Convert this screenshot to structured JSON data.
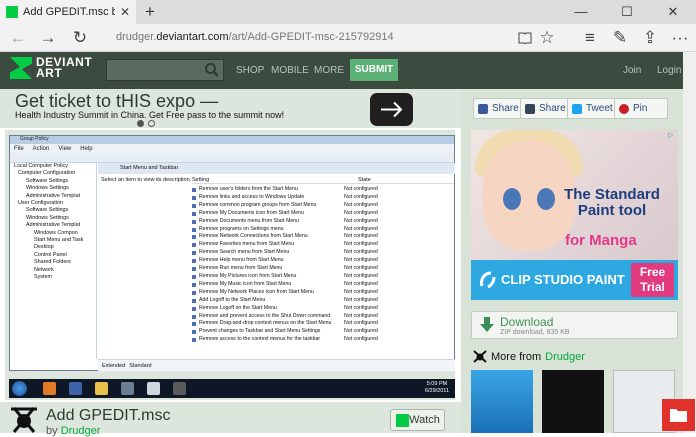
{
  "browser": {
    "tab_title": "Add GPEDIT.msc by Dru",
    "new_tab": "+",
    "url_prefix": "drudger.",
    "url_domain": "deviantart.com",
    "url_path": "/art/Add-GPEDIT-msc-215792914"
  },
  "site": {
    "logo_line1": "DEVIANT",
    "logo_line2": "ART",
    "nav": [
      "SHOP",
      "MOBILE",
      "MORE"
    ],
    "submit_label": "SUBMIT",
    "join": "Join",
    "login": "Login"
  },
  "promo": {
    "title": "Get ticket to tHIS expo —",
    "subtitle": "Health Industry Summit in China. Get Free pass to the summit now!"
  },
  "screenshot": {
    "window_title": "Group Policy",
    "menu": [
      "File",
      "Action",
      "View",
      "Help"
    ],
    "tree": [
      "Local Computer Policy",
      "Computer Configuration",
      "Software Settings",
      "Windows Settings",
      "Administrative Templat",
      "User Configuration",
      "Software Settings",
      "Windows Settings",
      "Administrative Templat",
      "Windows Compon",
      "Start Menu and Task",
      "Desktop",
      "Control Panel",
      "Shared Folders",
      "Network",
      "System"
    ],
    "folder_header": "Start Menu and Taskbar",
    "description": "Select an item to view its description.",
    "col_setting": "Setting",
    "col_state": "State",
    "settings": [
      "Remove user's folders from the Start Menu",
      "Remove links and access to Windows Update",
      "Remove common program groups from Start Menu",
      "Remove My Documents icon from Start Menu",
      "Remove Documents menu from Start Menu",
      "Remove programs on Settings menu",
      "Remove Network Connections from Start Menu",
      "Remove Favorites menu from Start Menu",
      "Remove Search menu from Start Menu",
      "Remove Help menu from Start Menu",
      "Remove Run menu from Start Menu",
      "Remove My Pictures icon from Start Menu",
      "Remove My Music icon from Start Menu",
      "Remove My Network Places icon from Start Menu",
      "Add Logoff to the Start Menu",
      "Remove Logoff on the Start Menu",
      "Remove and prevent access to the Shut Down command",
      "Remove Drag-and-drop context menus on the Start Menu",
      "Prevent changes to Taskbar and Start Menu Settings",
      "Remove access to the context menus for the taskbar"
    ],
    "state_value": "Not configured",
    "tabs": [
      "Extended",
      "Standard"
    ],
    "clock_time": "5:09 PM",
    "clock_date": "6/29/2011"
  },
  "deviation": {
    "title": "Add GPEDIT.msc",
    "by": "by",
    "author": "Drudger",
    "watch_label": "Watch"
  },
  "share": {
    "facebook": "Share",
    "tumblr": "Share",
    "twitter": "Tweet",
    "pinterest": "Pin"
  },
  "ad": {
    "line1": "The Standard",
    "line2": "Paint tool",
    "line3": "for Manga",
    "brand": "CLIP STUDIO PAINT",
    "free1": "Free",
    "free2": "Trial"
  },
  "download": {
    "label": "Download",
    "meta": "ZIP download, 835 KB"
  },
  "more_from": {
    "label": "More from",
    "author": "Drudger"
  },
  "colors": {
    "deviantart_green": "#05cc47",
    "header_bg": "#3c4b3f",
    "page_bg": "#dde6dc"
  }
}
